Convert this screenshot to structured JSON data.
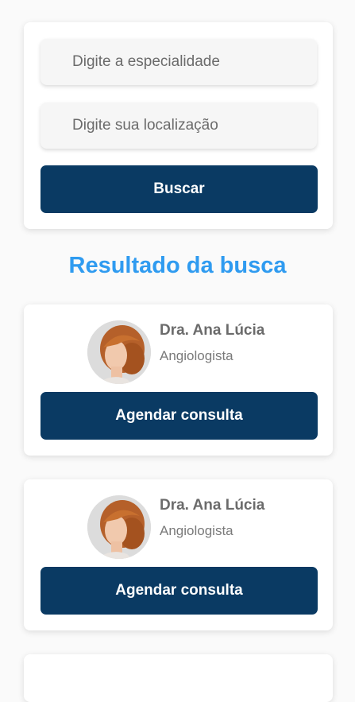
{
  "search": {
    "specialty_placeholder": "Digite a especialidade",
    "location_placeholder": "Digite sua localização",
    "button_label": "Buscar"
  },
  "results": {
    "title": "Resultado da busca",
    "doctors": [
      {
        "name": "Dra. Ana Lúcia",
        "specialty": "Angiologista",
        "button_label": "Agendar consulta"
      },
      {
        "name": "Dra. Ana Lúcia",
        "specialty": "Angiologista",
        "button_label": "Agendar consulta"
      }
    ]
  },
  "colors": {
    "primary_button": "#0a3a63",
    "title_accent": "#2f9bf0"
  }
}
